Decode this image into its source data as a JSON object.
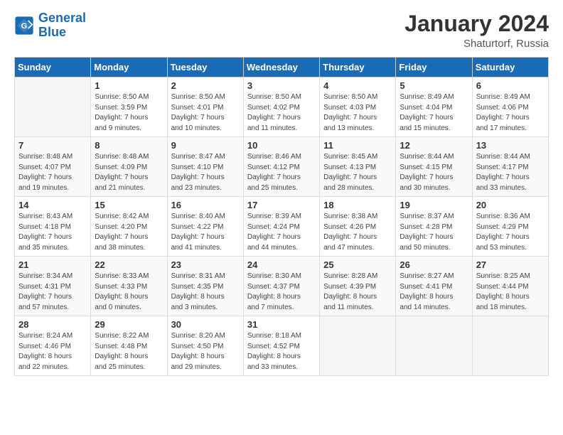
{
  "header": {
    "logo_general": "General",
    "logo_blue": "Blue",
    "title": "January 2024",
    "subtitle": "Shaturtorf, Russia"
  },
  "days_of_week": [
    "Sunday",
    "Monday",
    "Tuesday",
    "Wednesday",
    "Thursday",
    "Friday",
    "Saturday"
  ],
  "weeks": [
    [
      {
        "num": "",
        "info": ""
      },
      {
        "num": "1",
        "info": "Sunrise: 8:50 AM\nSunset: 3:59 PM\nDaylight: 7 hours\nand 9 minutes."
      },
      {
        "num": "2",
        "info": "Sunrise: 8:50 AM\nSunset: 4:01 PM\nDaylight: 7 hours\nand 10 minutes."
      },
      {
        "num": "3",
        "info": "Sunrise: 8:50 AM\nSunset: 4:02 PM\nDaylight: 7 hours\nand 11 minutes."
      },
      {
        "num": "4",
        "info": "Sunrise: 8:50 AM\nSunset: 4:03 PM\nDaylight: 7 hours\nand 13 minutes."
      },
      {
        "num": "5",
        "info": "Sunrise: 8:49 AM\nSunset: 4:04 PM\nDaylight: 7 hours\nand 15 minutes."
      },
      {
        "num": "6",
        "info": "Sunrise: 8:49 AM\nSunset: 4:06 PM\nDaylight: 7 hours\nand 17 minutes."
      }
    ],
    [
      {
        "num": "7",
        "info": "Sunrise: 8:48 AM\nSunset: 4:07 PM\nDaylight: 7 hours\nand 19 minutes."
      },
      {
        "num": "8",
        "info": "Sunrise: 8:48 AM\nSunset: 4:09 PM\nDaylight: 7 hours\nand 21 minutes."
      },
      {
        "num": "9",
        "info": "Sunrise: 8:47 AM\nSunset: 4:10 PM\nDaylight: 7 hours\nand 23 minutes."
      },
      {
        "num": "10",
        "info": "Sunrise: 8:46 AM\nSunset: 4:12 PM\nDaylight: 7 hours\nand 25 minutes."
      },
      {
        "num": "11",
        "info": "Sunrise: 8:45 AM\nSunset: 4:13 PM\nDaylight: 7 hours\nand 28 minutes."
      },
      {
        "num": "12",
        "info": "Sunrise: 8:44 AM\nSunset: 4:15 PM\nDaylight: 7 hours\nand 30 minutes."
      },
      {
        "num": "13",
        "info": "Sunrise: 8:44 AM\nSunset: 4:17 PM\nDaylight: 7 hours\nand 33 minutes."
      }
    ],
    [
      {
        "num": "14",
        "info": "Sunrise: 8:43 AM\nSunset: 4:18 PM\nDaylight: 7 hours\nand 35 minutes."
      },
      {
        "num": "15",
        "info": "Sunrise: 8:42 AM\nSunset: 4:20 PM\nDaylight: 7 hours\nand 38 minutes."
      },
      {
        "num": "16",
        "info": "Sunrise: 8:40 AM\nSunset: 4:22 PM\nDaylight: 7 hours\nand 41 minutes."
      },
      {
        "num": "17",
        "info": "Sunrise: 8:39 AM\nSunset: 4:24 PM\nDaylight: 7 hours\nand 44 minutes."
      },
      {
        "num": "18",
        "info": "Sunrise: 8:38 AM\nSunset: 4:26 PM\nDaylight: 7 hours\nand 47 minutes."
      },
      {
        "num": "19",
        "info": "Sunrise: 8:37 AM\nSunset: 4:28 PM\nDaylight: 7 hours\nand 50 minutes."
      },
      {
        "num": "20",
        "info": "Sunrise: 8:36 AM\nSunset: 4:29 PM\nDaylight: 7 hours\nand 53 minutes."
      }
    ],
    [
      {
        "num": "21",
        "info": "Sunrise: 8:34 AM\nSunset: 4:31 PM\nDaylight: 7 hours\nand 57 minutes."
      },
      {
        "num": "22",
        "info": "Sunrise: 8:33 AM\nSunset: 4:33 PM\nDaylight: 8 hours\nand 0 minutes."
      },
      {
        "num": "23",
        "info": "Sunrise: 8:31 AM\nSunset: 4:35 PM\nDaylight: 8 hours\nand 3 minutes."
      },
      {
        "num": "24",
        "info": "Sunrise: 8:30 AM\nSunset: 4:37 PM\nDaylight: 8 hours\nand 7 minutes."
      },
      {
        "num": "25",
        "info": "Sunrise: 8:28 AM\nSunset: 4:39 PM\nDaylight: 8 hours\nand 11 minutes."
      },
      {
        "num": "26",
        "info": "Sunrise: 8:27 AM\nSunset: 4:41 PM\nDaylight: 8 hours\nand 14 minutes."
      },
      {
        "num": "27",
        "info": "Sunrise: 8:25 AM\nSunset: 4:44 PM\nDaylight: 8 hours\nand 18 minutes."
      }
    ],
    [
      {
        "num": "28",
        "info": "Sunrise: 8:24 AM\nSunset: 4:46 PM\nDaylight: 8 hours\nand 22 minutes."
      },
      {
        "num": "29",
        "info": "Sunrise: 8:22 AM\nSunset: 4:48 PM\nDaylight: 8 hours\nand 25 minutes."
      },
      {
        "num": "30",
        "info": "Sunrise: 8:20 AM\nSunset: 4:50 PM\nDaylight: 8 hours\nand 29 minutes."
      },
      {
        "num": "31",
        "info": "Sunrise: 8:18 AM\nSunset: 4:52 PM\nDaylight: 8 hours\nand 33 minutes."
      },
      {
        "num": "",
        "info": ""
      },
      {
        "num": "",
        "info": ""
      },
      {
        "num": "",
        "info": ""
      }
    ]
  ]
}
